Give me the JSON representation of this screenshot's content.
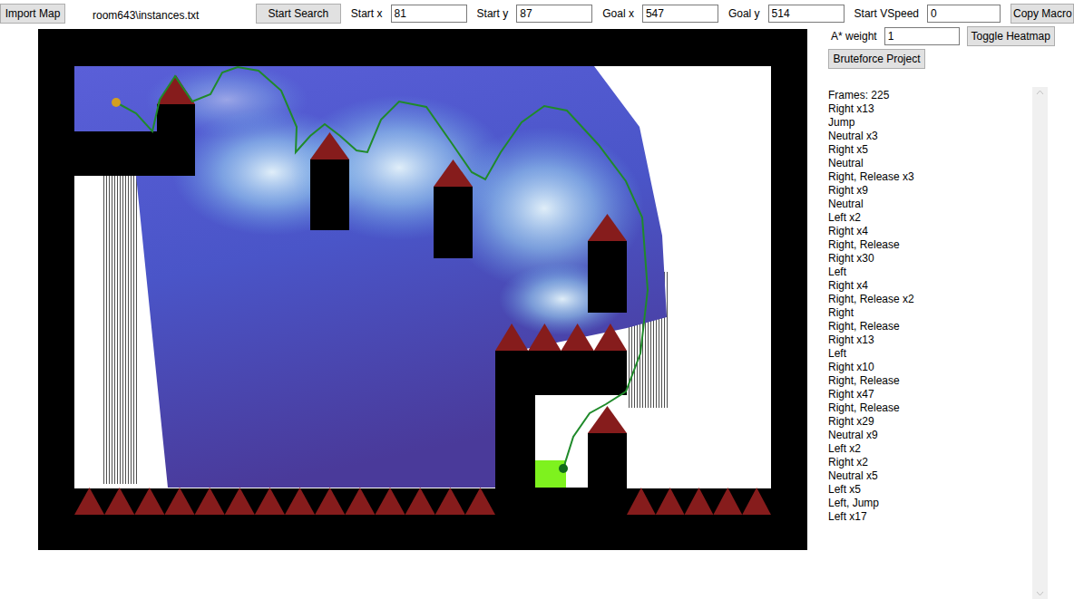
{
  "toolbar": {
    "import_button": "Import Map",
    "file": "room643\\instances.txt",
    "search_button": "Start Search",
    "fields": [
      {
        "label": "Start x",
        "value": "81"
      },
      {
        "label": "Start y",
        "value": "87"
      },
      {
        "label": "Goal x",
        "value": "547"
      },
      {
        "label": "Goal y",
        "value": "514"
      },
      {
        "label": "Start VSpeed",
        "value": "0"
      }
    ],
    "copy_button": "Copy Macro"
  },
  "options": {
    "weight_label": "A* weight",
    "weight_value": "1",
    "heatmap_button": "Toggle Heatmap",
    "bruteforce_button": "Bruteforce Project"
  },
  "map": {
    "heatmap_visible": true
  },
  "macro": {
    "frames": "Frames: 225",
    "steps": [
      "Right x13",
      "Jump",
      "Neutral x3",
      "Right x5",
      "Neutral",
      "Right, Release x3",
      "Right x9",
      "Neutral",
      "Left x2",
      "Right x4",
      "Right, Release",
      "Right x30",
      "Left",
      "Right x4",
      "Right, Release x2",
      "Right",
      "Right, Release",
      "Right x13",
      "Left",
      "Right x10",
      "Right, Release",
      "Right x47",
      "Right, Release",
      "Right x29",
      "Neutral x9",
      "Left x2",
      "Right x2",
      "Neutral x5",
      "Left x5",
      "Left, Jump",
      "Left x17"
    ]
  }
}
